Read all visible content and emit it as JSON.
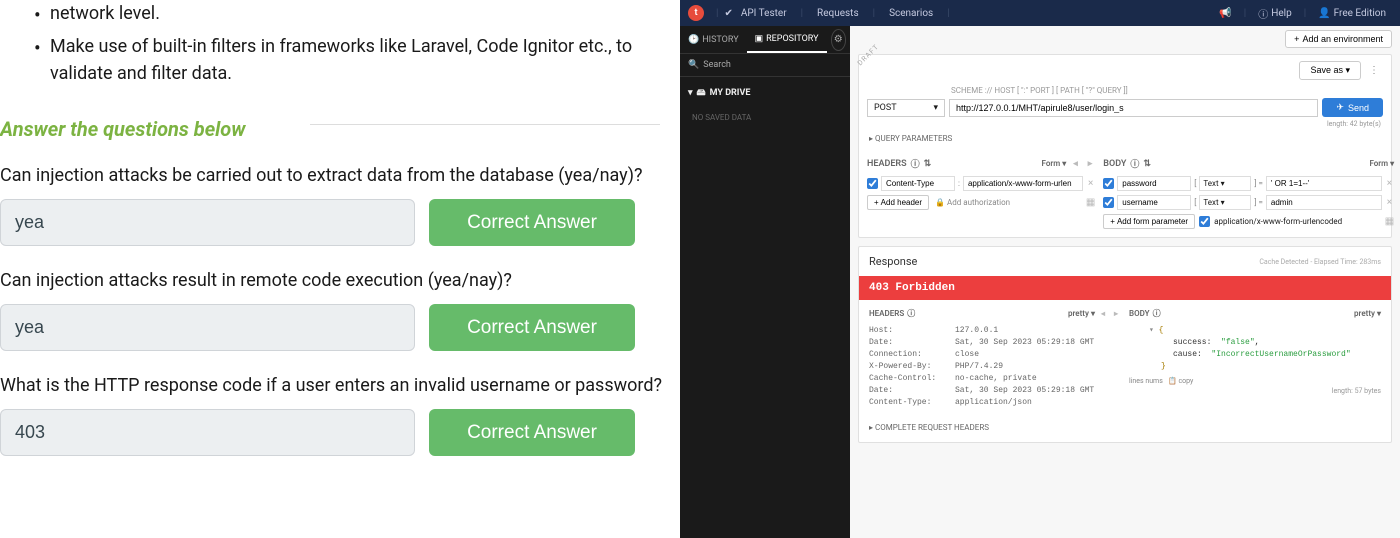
{
  "left": {
    "text1": "network level.",
    "bullet2": "Make use of built-in filters in frameworks like Laravel, Code Ignitor etc., to validate and filter data.",
    "heading": "Answer the questions below",
    "q1": "Can injection attacks be carried out to extract data from the database (yea/nay)?",
    "a1": "yea",
    "q2": "Can injection attacks result in remote code execution (yea/nay)?",
    "a2": "yea",
    "q3": "What is the HTTP response code if a user enters an invalid username or password?",
    "a3": "403",
    "correct": "Correct Answer"
  },
  "api": {
    "top": {
      "title": "API Tester",
      "requests": "Requests",
      "scenarios": "Scenarios",
      "help": "Help",
      "edition": "Free Edition"
    },
    "sidebar": {
      "history": "HISTORY",
      "repository": "REPOSITORY",
      "search": "Search",
      "drive": "MY DRIVE",
      "nodata": "NO SAVED DATA"
    },
    "env_btn": "Add an environment",
    "save_as": "Save as",
    "scheme": "SCHEME :// HOST [ \":\" PORT ] [ PATH [ \"?\" QUERY ]]",
    "method": "POST",
    "url": "http://127.0.0.1/MHT/apirule8/user/login_s",
    "send": "Send",
    "length": "length: 42 byte(s)",
    "qp": "QUERY PARAMETERS",
    "headers_label": "HEADERS",
    "body_label": "BODY",
    "form_label": "Form",
    "header1_name": "Content-Type",
    "header1_val": "application/x-www-form-urlen",
    "add_header": "Add header",
    "add_auth": "Add authorization",
    "body1_name": "password",
    "body1_type": "Text",
    "body1_val": "' OR 1=1--'",
    "body2_name": "username",
    "body2_type": "Text",
    "body2_val": "admin",
    "add_param": "Add form parameter",
    "enc": "application/x-www-form-urlencoded",
    "response": {
      "title": "Response",
      "cache": "Cache Detected - Elapsed Time: 283ms",
      "status": "403 Forbidden",
      "pretty": "pretty",
      "headers": [
        {
          "k": "Host:",
          "v": "127.0.0.1"
        },
        {
          "k": "Date:",
          "v": "Sat, 30 Sep 2023 05:29:18 GMT"
        },
        {
          "k": "Connection:",
          "v": "close"
        },
        {
          "k": "X-Powered-By:",
          "v": "PHP/7.4.29"
        },
        {
          "k": "Cache-Control:",
          "v": "no-cache, private"
        },
        {
          "k": "Date:",
          "v": "Sat, 30 Sep 2023 05:29:18 GMT"
        },
        {
          "k": "Content-Type:",
          "v": "application/json"
        }
      ],
      "json": {
        "success_key": "success:",
        "success_val": "\"false\"",
        "cause_key": "cause:",
        "cause_val": "\"IncorrectUsernameOrPassword\""
      },
      "linenums": "lines nums",
      "copy": "copy",
      "body_len": "length: 57 bytes",
      "complete": "COMPLETE REQUEST HEADERS"
    }
  }
}
